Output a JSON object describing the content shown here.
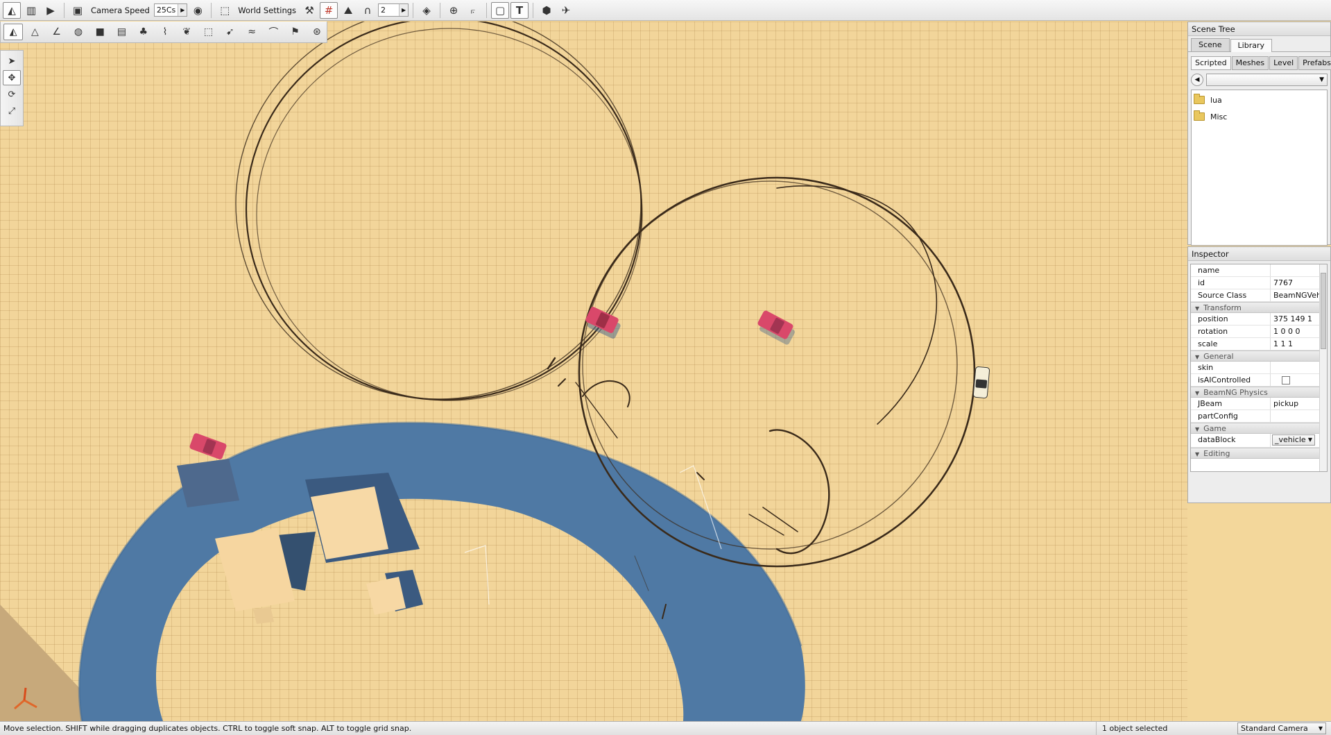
{
  "toolbar": {
    "camera_speed_label": "Camera Speed",
    "camera_speed_value": "25Cs",
    "world_settings_label": "World Settings",
    "snap_value": "2"
  },
  "scene_tree": {
    "title": "Scene Tree",
    "tabs": [
      "Scene",
      "Library"
    ],
    "selected_tab": "Library",
    "subtabs": [
      "Scripted",
      "Meshes",
      "Level",
      "Prefabs"
    ],
    "selected_subtab": "Scripted",
    "folders": [
      "lua",
      "Misc"
    ]
  },
  "inspector": {
    "title": "Inspector",
    "rows": {
      "name": {
        "label": "name",
        "value": ""
      },
      "id": {
        "label": "id",
        "value": "7767"
      },
      "source_class": {
        "label": "Source Class",
        "value": "BeamNGVeh"
      }
    },
    "groups": {
      "transform": "Transform",
      "general": "General",
      "physics": "BeamNG Physics",
      "game": "Game",
      "editing": "Editing"
    },
    "transform": {
      "position": {
        "label": "position",
        "value": "375 149 1"
      },
      "rotation": {
        "label": "rotation",
        "value": "1 0 0 0"
      },
      "scale": {
        "label": "scale",
        "value": "1 1 1"
      }
    },
    "general": {
      "skin": {
        "label": "skin",
        "value": ""
      },
      "is_ai": {
        "label": "isAIControlled",
        "checked": false
      }
    },
    "physics": {
      "jbeam": {
        "label": "JBeam",
        "value": "pickup"
      },
      "part_config": {
        "label": "partConfig",
        "value": ""
      }
    },
    "game": {
      "datablock": {
        "label": "dataBlock",
        "value": "_vehicle"
      }
    }
  },
  "status": {
    "message": "Move selection.  SHIFT while dragging duplicates objects.  CTRL to toggle soft snap.  ALT to toggle grid snap.",
    "selection": "1 object selected",
    "camera_mode": "Standard Camera"
  },
  "colors": {
    "ground": "#f2d59a",
    "water": "#4f79a4",
    "vehicle_red": "#d9486a",
    "tire_marks": "#3a2a1a"
  },
  "icons": {
    "toolbar": [
      "terrain-editor-icon",
      "panels-icon",
      "play-icon",
      "camera-icon",
      "visibility-eye-icon",
      "screenshot-icon",
      "wrench-icon",
      "grid-snap-icon",
      "terrain-snap-icon",
      "magnet-icon",
      "snap-arrow-icon",
      "object-icon",
      "bounds-icon",
      "measure-icon",
      "select-frame-icon",
      "text-icon",
      "box-icon",
      "bird-icon"
    ],
    "toolbar2": [
      "object-editor-icon",
      "terrain-icon",
      "painter-icon",
      "sphere-icon",
      "cube-icon",
      "path-icon",
      "tree-icon",
      "brush-icon",
      "leaf-icon",
      "road-icon",
      "decal-icon",
      "river-icon",
      "mesh-road-icon",
      "flag-icon",
      "wheel-icon"
    ],
    "left": [
      "select-arrow-icon",
      "move-icon",
      "rotate-icon",
      "scale-icon"
    ]
  }
}
